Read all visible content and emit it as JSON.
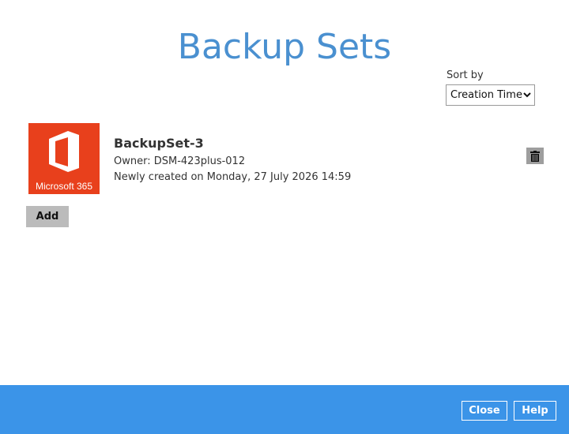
{
  "header": {
    "title": "Backup Sets"
  },
  "sort": {
    "label": "Sort by",
    "selected": "Creation Time"
  },
  "backup_sets": [
    {
      "logo_text": "Microsoft 365",
      "logo_color": "#e8401c",
      "name": "BackupSet-3",
      "owner": "Owner: DSM-423plus-012",
      "created": "Newly created on Monday, 27 July 2026 14:59",
      "delete_icon": "trash-icon"
    }
  ],
  "actions": {
    "add_label": "Add"
  },
  "footer": {
    "close_label": "Close",
    "help_label": "Help",
    "color": "#3b94e8"
  },
  "colors": {
    "title": "#4a90d0"
  }
}
